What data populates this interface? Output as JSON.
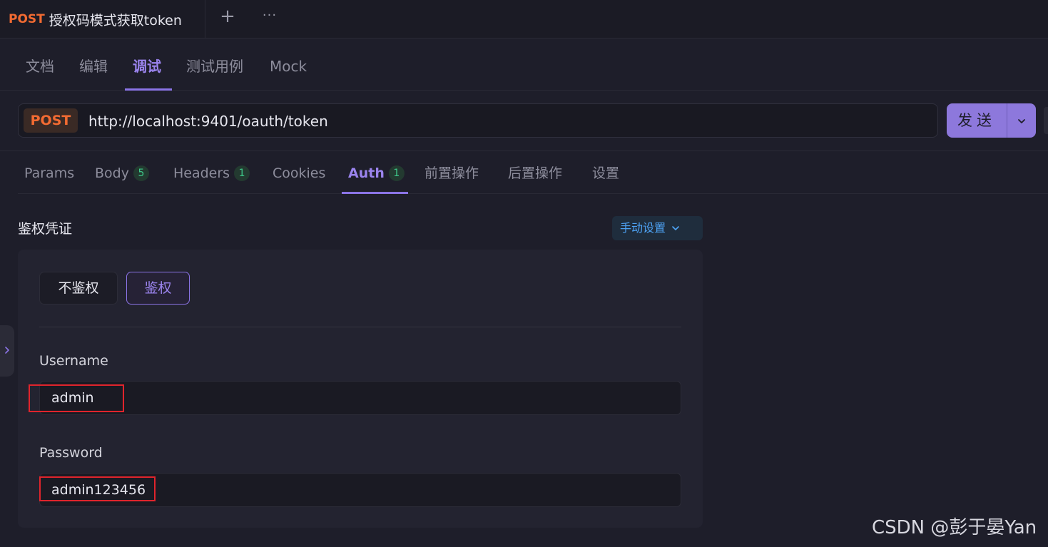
{
  "request_tab": {
    "method": "POST",
    "title": "授权码模式获取token"
  },
  "toolbar": {
    "add_symbol": "+",
    "more_symbol": "···"
  },
  "mode_tabs": [
    "文档",
    "编辑",
    "调试",
    "测试用例",
    "Mock"
  ],
  "url_bar": {
    "method": "POST",
    "url": "http://localhost:9401/oauth/token"
  },
  "send": {
    "label": "发送"
  },
  "sub_tabs": [
    {
      "label": "Params",
      "badge": ""
    },
    {
      "label": "Body",
      "badge": "5"
    },
    {
      "label": "Headers",
      "badge": "1"
    },
    {
      "label": "Cookies",
      "badge": ""
    },
    {
      "label": "Auth",
      "badge": "1"
    },
    {
      "label": "前置操作",
      "badge": ""
    },
    {
      "label": "后置操作",
      "badge": ""
    },
    {
      "label": "设置",
      "badge": ""
    }
  ],
  "auth": {
    "section_title": "鉴权凭证",
    "mode_select": "手动设置",
    "option_off": "不鉴权",
    "option_on": "鉴权",
    "username_label": "Username",
    "username_value": "admin",
    "password_label": "Password",
    "password_value": "admin123456"
  },
  "watermark": "CSDN @彭于晏Yan",
  "colors": {
    "accent": "#8b74e6",
    "post_method": "#f26b32",
    "badge_green": "#3ec98a",
    "link_blue": "#4ea3f5",
    "highlight_red": "#e0242c"
  }
}
